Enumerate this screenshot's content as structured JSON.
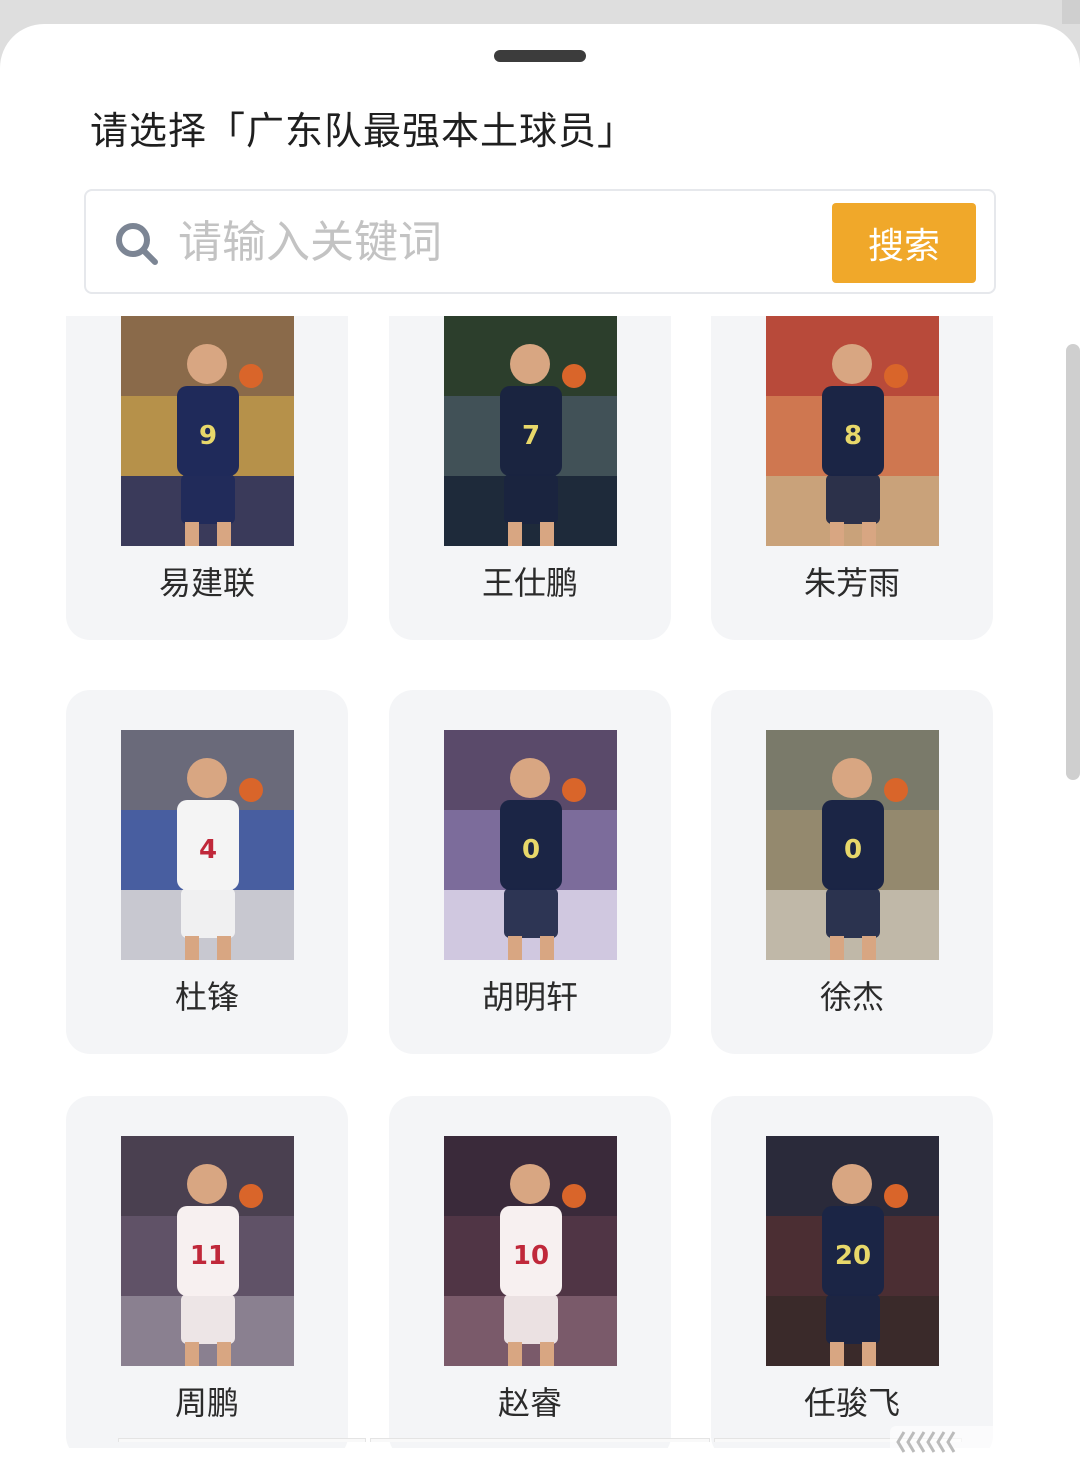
{
  "title": "请选择「广东队最强本土球员」",
  "search": {
    "placeholder": "请输入关键词",
    "button_label": "搜索"
  },
  "players": [
    {
      "name": "易建联",
      "jersey_color": "#1f2a5a",
      "number": "9"
    },
    {
      "name": "王仕鹏",
      "jersey_color": "#1a2440",
      "number": "7"
    },
    {
      "name": "朱芳雨",
      "jersey_color": "#1b2545",
      "number": "8"
    },
    {
      "name": "杜锋",
      "jersey_color": "#f4f4f4",
      "number": "4"
    },
    {
      "name": "胡明轩",
      "jersey_color": "#1b2545",
      "number": "0"
    },
    {
      "name": "徐杰",
      "jersey_color": "#1b2545",
      "number": "0"
    },
    {
      "name": "周鹏",
      "jersey_color": "#f7f0f0",
      "number": "11"
    },
    {
      "name": "赵睿",
      "jersey_color": "#f7f0f0",
      "number": "10"
    },
    {
      "name": "任骏飞",
      "jersey_color": "#1b2545",
      "number": "20"
    }
  ],
  "colors": {
    "accent": "#f0a82a",
    "card_bg": "#f4f5f7"
  }
}
